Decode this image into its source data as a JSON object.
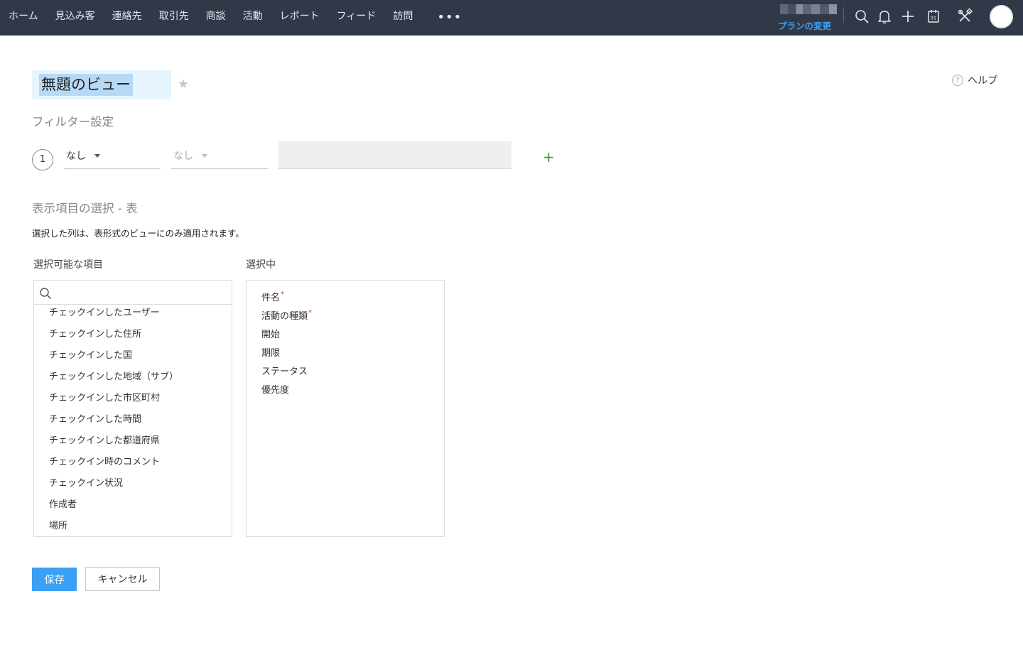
{
  "nav": {
    "items": [
      "ホーム",
      "見込み客",
      "連絡先",
      "取引先",
      "商談",
      "活動",
      "レポート",
      "フィード",
      "訪問"
    ],
    "more": "•••"
  },
  "header": {
    "plan_change": "プランの変更",
    "icons": [
      "search-icon",
      "bell-icon",
      "plus-icon",
      "calendar-icon",
      "tools-icon",
      "avatar"
    ]
  },
  "view": {
    "title": "無題のビュー",
    "star": "★",
    "help": "ヘルプ",
    "help_icon": "?"
  },
  "filter": {
    "section_title": "フィルター設定",
    "row_number": "1",
    "field_value": "なし",
    "condition_value": "なし",
    "add": "+"
  },
  "columns": {
    "section_title": "表示項目の選択 - 表",
    "description": "選択した列は、表形式のビューにのみ適用されます。",
    "available_label": "選択可能な項目",
    "selected_label": "選択中",
    "search_placeholder": "",
    "available": [
      "チェックインしたユーザー",
      "チェックインした住所",
      "チェックインした国",
      "チェックインした地域（サブ）",
      "チェックインした市区町村",
      "チェックインした時間",
      "チェックインした都道府県",
      "チェックイン時のコメント",
      "チェックイン状況",
      "作成者",
      "場所"
    ],
    "selected": [
      {
        "label": "件名",
        "required": "*"
      },
      {
        "label": "活動の種類",
        "required": "*"
      },
      {
        "label": "開始",
        "required": ""
      },
      {
        "label": "期限",
        "required": ""
      },
      {
        "label": "ステータス",
        "required": ""
      },
      {
        "label": "優先度",
        "required": ""
      }
    ]
  },
  "actions": {
    "save": "保存",
    "cancel": "キャンセル"
  },
  "colors": {
    "topbar": "#313949",
    "accent": "#3aa0f3",
    "add": "#3c9b2a",
    "required": "#d23b3b"
  }
}
